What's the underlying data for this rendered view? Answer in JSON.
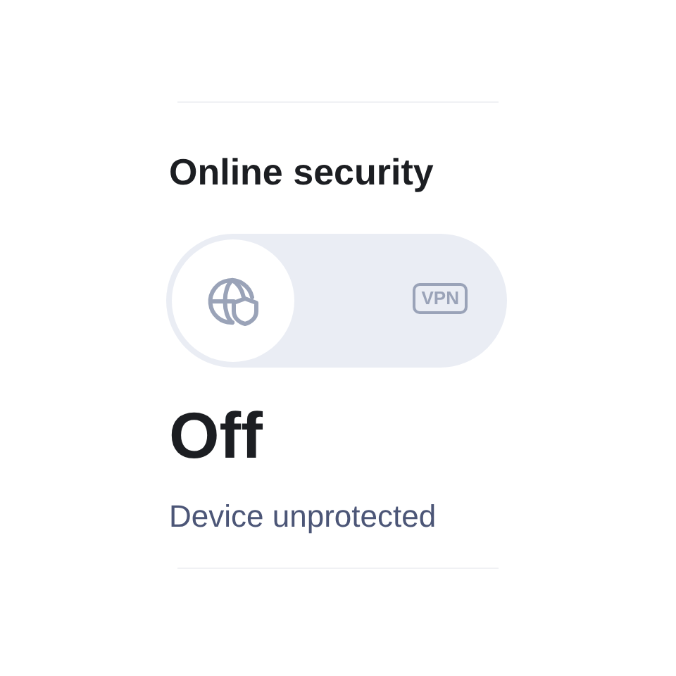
{
  "title": "Online security",
  "toggle": {
    "on": false,
    "badge": "VPN"
  },
  "status": "Off",
  "description": "Device unprotected"
}
